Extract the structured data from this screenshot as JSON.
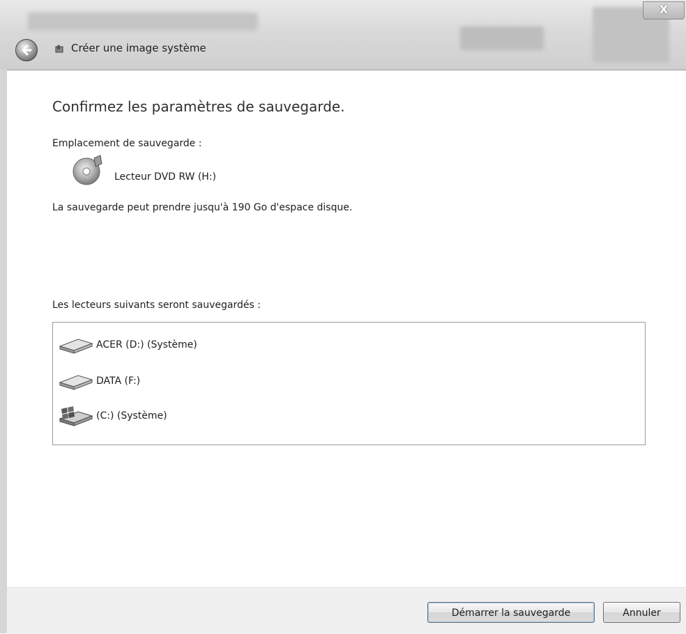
{
  "window": {
    "title": "Créer une image système",
    "close_label": "X"
  },
  "page": {
    "heading": "Confirmez les paramètres de sauvegarde."
  },
  "location": {
    "label": "Emplacement de sauvegarde :",
    "device": "Lecteur DVD RW (H:)",
    "device_icon": "dvd-drive-icon"
  },
  "space_note": "La sauvegarde peut prendre jusqu'à 190 Go d'espace disque.",
  "drives": {
    "label": "Les lecteurs suivants seront sauvegardés :",
    "items": [
      {
        "name": "ACER (D:) (Système)",
        "icon": "hard-drive-icon"
      },
      {
        "name": "DATA (F:)",
        "icon": "hard-drive-icon"
      },
      {
        "name": "(C:) (Système)",
        "icon": "windows-drive-icon"
      }
    ]
  },
  "buttons": {
    "start": "Démarrer la sauvegarde",
    "cancel": "Annuler"
  }
}
